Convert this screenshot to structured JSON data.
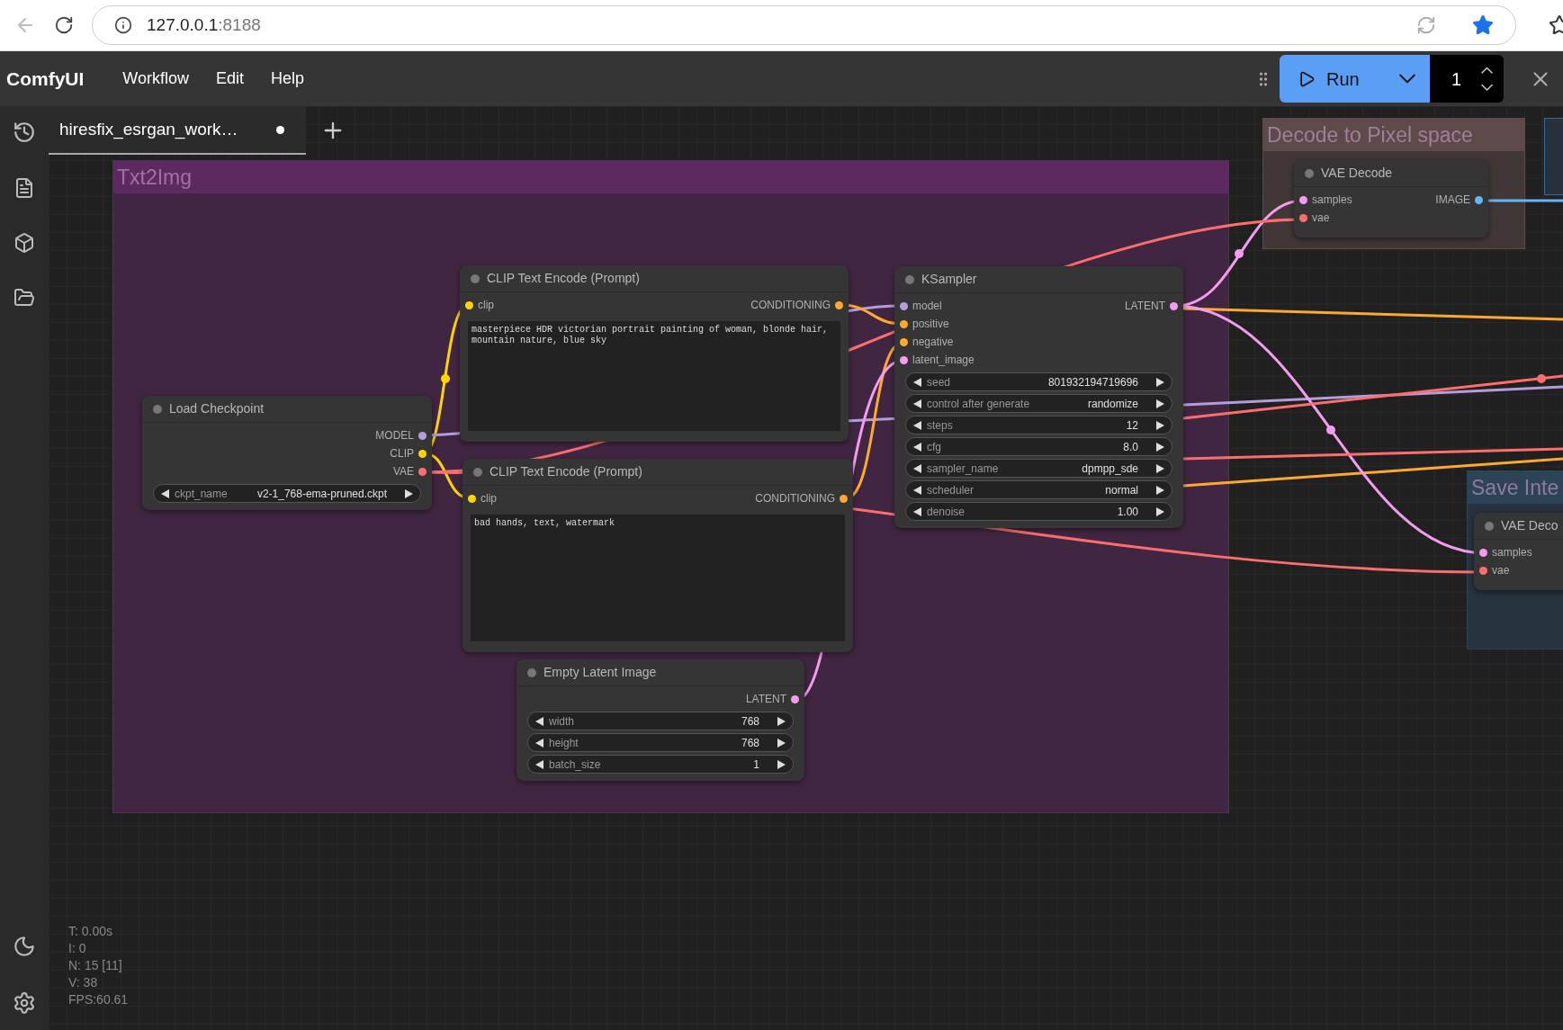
{
  "browser": {
    "url_host": "127.0.0.1",
    "url_port": ":8188"
  },
  "app": {
    "title": "ComfyUI",
    "menu": [
      "Workflow",
      "Edit",
      "Help"
    ],
    "run_label": "Run",
    "batch_count": "1"
  },
  "tabs": [
    {
      "label": "hiresfix_esrgan_work…",
      "selected": true,
      "modified": true
    }
  ],
  "groups": [
    {
      "title": "Txt2Img",
      "color": "#5c2a5e"
    },
    {
      "title": "Decode to Pixel space",
      "color": "#5e4a4a"
    },
    {
      "title": "Save Inte",
      "color": "#2d4357"
    }
  ],
  "nodes": [
    {
      "title": "Load Checkpoint",
      "outputs": [
        {
          "name": "MODEL",
          "color": "#b39ddb"
        },
        {
          "name": "CLIP",
          "color": "#ffd500"
        },
        {
          "name": "VAE",
          "color": "#ff6e6e"
        }
      ],
      "widgets": [
        {
          "label": "ckpt_name",
          "value": "v2-1_768-ema-pruned.ckpt"
        }
      ]
    },
    {
      "title": "CLIP Text Encode (Prompt)",
      "inputs": [
        {
          "name": "clip",
          "color": "#ffd500"
        }
      ],
      "outputs": [
        {
          "name": "CONDITIONING",
          "color": "#ffa931"
        }
      ],
      "prompt": "masterpiece HDR victorian portrait painting of woman, blonde hair, mountain nature, blue sky"
    },
    {
      "title": "CLIP Text Encode (Prompt)",
      "inputs": [
        {
          "name": "clip",
          "color": "#ffd500"
        }
      ],
      "outputs": [
        {
          "name": "CONDITIONING",
          "color": "#ffa931"
        }
      ],
      "prompt": "bad hands, text, watermark"
    },
    {
      "title": "Empty Latent Image",
      "outputs": [
        {
          "name": "LATENT",
          "color": "#f49cf0"
        }
      ],
      "widgets": [
        {
          "label": "width",
          "value": "768"
        },
        {
          "label": "height",
          "value": "768"
        },
        {
          "label": "batch_size",
          "value": "1"
        }
      ]
    },
    {
      "title": "KSampler",
      "inputs": [
        {
          "name": "model",
          "color": "#b39ddb"
        },
        {
          "name": "positive",
          "color": "#ffa931"
        },
        {
          "name": "negative",
          "color": "#ffa931"
        },
        {
          "name": "latent_image",
          "color": "#f49cf0"
        }
      ],
      "outputs": [
        {
          "name": "LATENT",
          "color": "#f49cf0"
        }
      ],
      "widgets": [
        {
          "label": "seed",
          "value": "801932194719696"
        },
        {
          "label": "control after generate",
          "value": "randomize"
        },
        {
          "label": "steps",
          "value": "12"
        },
        {
          "label": "cfg",
          "value": "8.0"
        },
        {
          "label": "sampler_name",
          "value": "dpmpp_sde"
        },
        {
          "label": "scheduler",
          "value": "normal"
        },
        {
          "label": "denoise",
          "value": "1.00"
        }
      ]
    },
    {
      "title": "VAE Decode",
      "inputs": [
        {
          "name": "samples",
          "color": "#f49cf0"
        },
        {
          "name": "vae",
          "color": "#ff6e6e"
        }
      ],
      "outputs": [
        {
          "name": "IMAGE",
          "color": "#64b5f6"
        }
      ]
    },
    {
      "title": "VAE Deco",
      "inputs": [
        {
          "name": "samples",
          "color": "#f49cf0"
        },
        {
          "name": "vae",
          "color": "#ff6e6e"
        }
      ]
    }
  ],
  "stats": [
    "T: 0.00s",
    "I: 0",
    "N: 15 [11]",
    "V: 38",
    "FPS:60.61"
  ]
}
